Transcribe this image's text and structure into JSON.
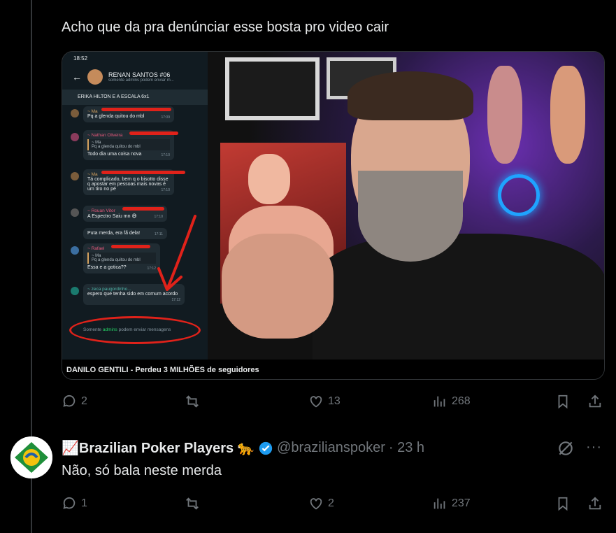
{
  "post": {
    "text": "Acho que da pra denúnciar esse bosta pro video cair",
    "media_caption": "DANILO GENTILI - Perdeu 3 MILHÕES de seguidores",
    "phone": {
      "time": "18:52",
      "group_name": "RENAN SANTOS #06",
      "group_sub": "somente admins podem enviar m...",
      "pinned": "ERIKA HILTON E A ESCALA 6x1",
      "admin_note_pre": "Somente",
      "admin_note_link": "admins",
      "admin_note_post": "podem enviar mensagens",
      "messages": [
        {
          "sender": "~ Ma",
          "text": "Pq a glenda quitou do mbl",
          "time": "17:09"
        },
        {
          "sender": "~ Nathan Oliveira",
          "quote_sender": "~ Ma",
          "quote": "Pq a glenda quitou do mbl",
          "text": "Todo dia uma coisa nova",
          "time": "17:10"
        },
        {
          "sender": "~ Ma",
          "text": "Tá complicado, bem q o bisotto disse q apostar em pessoas mais novas é um tiro no pé",
          "time": "17:10"
        },
        {
          "sender": "~ Rouan Vitor",
          "text": "A Espectro Saiu mn 😅",
          "time": "17:10"
        },
        {
          "sender": "",
          "text": "Puta merda, era fã dela!",
          "time": "17:11"
        },
        {
          "sender": "~ Rafael",
          "quote_sender": "~ Ma",
          "quote": "Pq a glenda quitou do mbl",
          "text": "Essa e a gotica??",
          "time": "17:12"
        },
        {
          "sender": "~ zeca paugordinho...",
          "text": "espero que tenha sido em comum acordo",
          "time": "17:12"
        }
      ]
    },
    "stats": {
      "replies": "2",
      "reposts": "",
      "likes": "13",
      "views": "268"
    }
  },
  "reply": {
    "display_name": "📈Brazilian Poker Players",
    "emoji": "🐆",
    "handle": "@brazilianspoker",
    "time": "· 23 h",
    "text": "Não, só bala neste merda",
    "stats": {
      "replies": "1",
      "reposts": "",
      "likes": "2",
      "views": "237"
    }
  },
  "colors": {
    "accent": "#1d9bf0",
    "muted": "#71767b",
    "text": "#e7e9ea"
  }
}
